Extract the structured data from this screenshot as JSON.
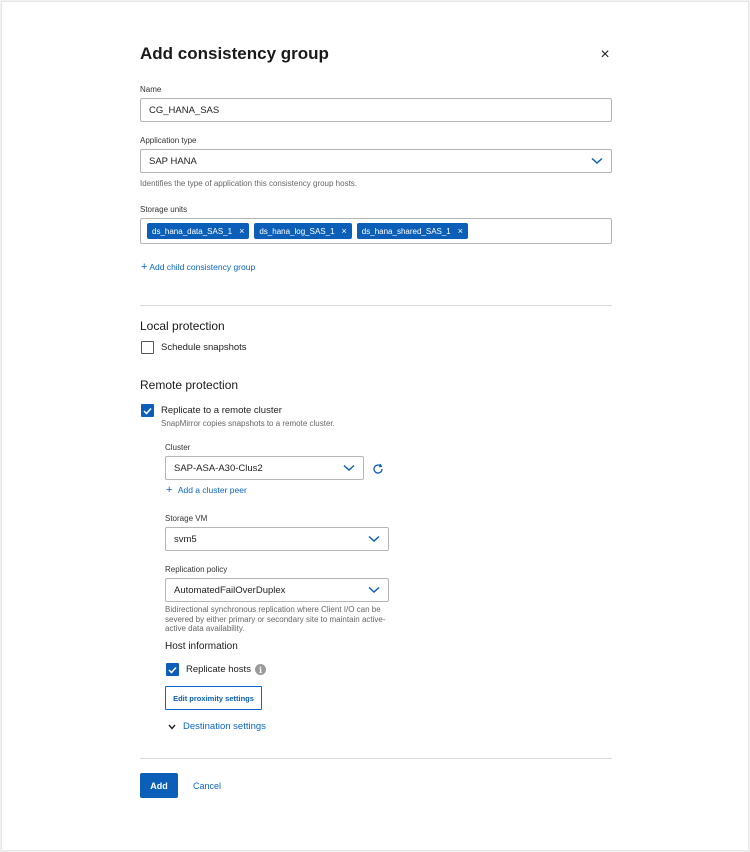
{
  "dialog": {
    "title": "Add consistency group",
    "close_glyph": "×"
  },
  "name_field": {
    "label": "Name",
    "value": "CG_HANA_SAS"
  },
  "application_type": {
    "label": "Application type",
    "value": "SAP HANA",
    "help": "Identifies the type of application this consistency group hosts."
  },
  "storage_units": {
    "label": "Storage units",
    "tokens": [
      "ds_hana_data_SAS_1",
      "ds_hana_log_SAS_1",
      "ds_hana_shared_SAS_1"
    ],
    "remove_glyph": "×"
  },
  "add_child": {
    "plus": "+",
    "label": "Add child consistency group"
  },
  "local_protection": {
    "heading": "Local protection",
    "schedule_label": "Schedule snapshots",
    "schedule_checked": false
  },
  "remote_protection": {
    "heading": "Remote protection",
    "replicate_label": "Replicate to a remote cluster",
    "replicate_checked": true,
    "replicate_help": "SnapMirror copies snapshots to a remote cluster.",
    "cluster": {
      "label": "Cluster",
      "value": "SAP-ASA-A30-Clus2",
      "add_peer_plus": "+",
      "add_peer_label": "Add a cluster peer"
    },
    "storage_vm": {
      "label": "Storage VM",
      "value": "svm5"
    },
    "replication_policy": {
      "label": "Replication policy",
      "value": "AutomatedFailOverDuplex",
      "help_line1": "Bidirectional synchronous replication where Client I/O can be",
      "help_line2": "severed by either primary or secondary site to maintain active-",
      "help_line3": "active data availability."
    },
    "host_information": {
      "heading": "Host information",
      "replicate_hosts_label": "Replicate hosts",
      "replicate_hosts_checked": true,
      "info_glyph": "i",
      "edit_proximity_label": "Edit proximity settings"
    },
    "destination_settings_label": "Destination settings"
  },
  "footer": {
    "add_label": "Add",
    "cancel_label": "Cancel"
  },
  "colors": {
    "primary": "#0b5fb8",
    "link": "#0b66c8"
  }
}
